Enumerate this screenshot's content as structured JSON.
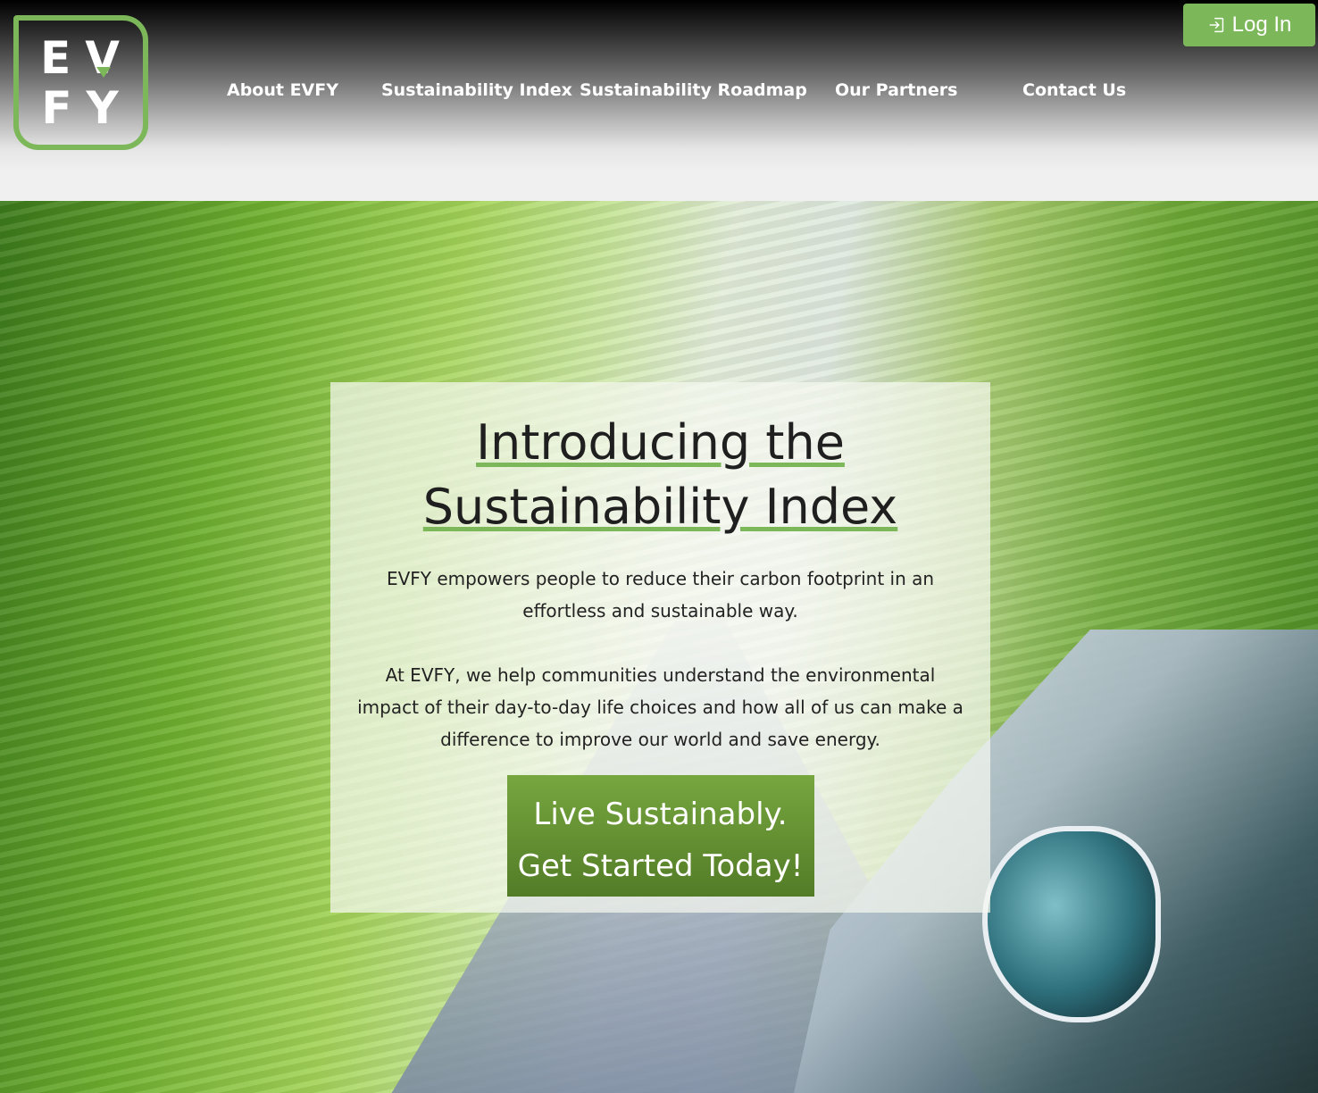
{
  "header": {
    "logo": {
      "row1": "EV",
      "row2": "FY",
      "v_letter": "V",
      "e_letter": "E",
      "f_letter": "F",
      "y_letter": "Y"
    },
    "nav": [
      {
        "label": "About EVFY"
      },
      {
        "label": "Sustainability Index"
      },
      {
        "label": "Sustainability Roadmap"
      },
      {
        "label": "Our Partners"
      },
      {
        "label": "Contact Us"
      }
    ],
    "login_label": "Log In"
  },
  "hero": {
    "title_line1": "Introducing the",
    "title_line2": "Sustainability Index",
    "paragraph1": "EVFY empowers people to reduce their carbon footprint in an effortless and sustainable way.",
    "paragraph2": "At EVFY, we help communities understand the environmental impact of their day-to-day life choices and how all of us can make a difference to improve our world and save energy.",
    "cta_line1": "Live Sustainably.",
    "cta_line2": "Get Started Today!"
  },
  "colors": {
    "accent": "#7cb85a",
    "cta_top": "#77a63f",
    "cta_bottom": "#537c27"
  },
  "icons": {
    "login": "sign-in-icon",
    "logo_tip": "lightning-tip-icon"
  }
}
